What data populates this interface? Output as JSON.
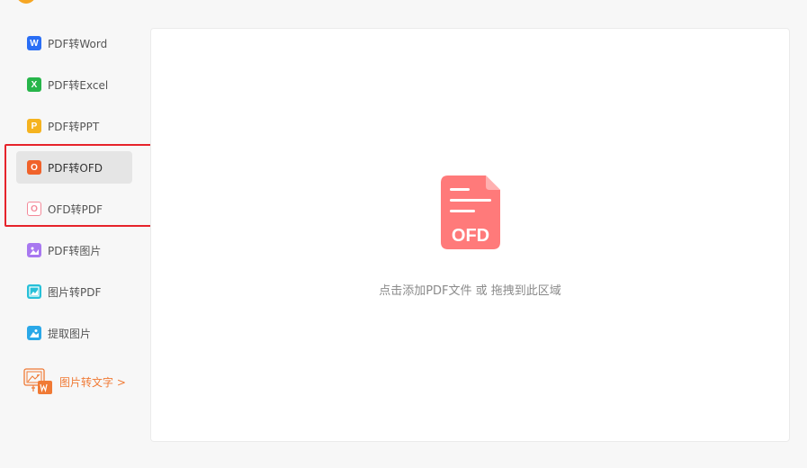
{
  "sidebar": {
    "items": [
      {
        "label": "PDF转Word",
        "icon": "word-icon",
        "glyph": "W"
      },
      {
        "label": "PDF转Excel",
        "icon": "excel-icon",
        "glyph": "X"
      },
      {
        "label": "PDF转PPT",
        "icon": "ppt-icon",
        "glyph": "P"
      },
      {
        "label": "PDF转OFD",
        "icon": "ofd-icon",
        "glyph": "O",
        "active": true
      },
      {
        "label": "OFD转PDF",
        "icon": "ofd-to-pdf-icon",
        "glyph": "O"
      },
      {
        "label": "PDF转图片",
        "icon": "image-icon"
      },
      {
        "label": "图片转PDF",
        "icon": "image-to-pdf-icon"
      },
      {
        "label": "提取图片",
        "icon": "extract-image-icon"
      }
    ],
    "ocr_link": "图片转文字 >"
  },
  "dropzone": {
    "icon_text": "OFD",
    "hint": "点击添加PDF文件 或 拖拽到此区域"
  },
  "colors": {
    "highlight": "#e6232b",
    "accent_orange": "#f07a35",
    "ofd_icon": "#ff7a7a"
  }
}
